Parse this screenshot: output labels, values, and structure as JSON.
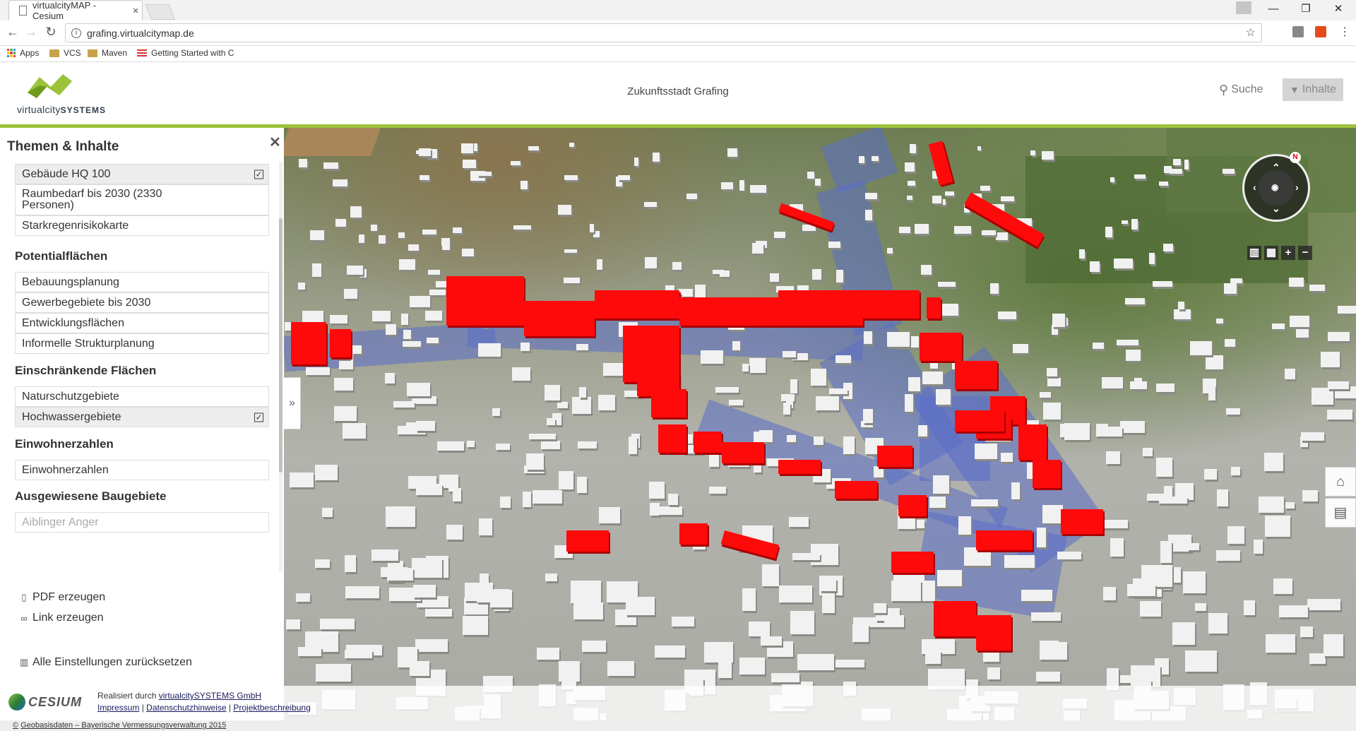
{
  "browser": {
    "tab_title": "virtualcityMAP - Cesium",
    "tab_close": "×",
    "url": "grafing.virtualcitymap.de",
    "bookmarks": [
      {
        "label": "Apps"
      },
      {
        "label": "VCS"
      },
      {
        "label": "Maven"
      },
      {
        "label": "Getting Started with C"
      }
    ],
    "window_controls": {
      "minimize": "—",
      "maximize": "❐",
      "close": "✕"
    }
  },
  "app": {
    "logo_text_a": "virtualcity",
    "logo_text_b": "SYSTEMS",
    "title": "Zukunftsstadt Grafing",
    "search_label": "Suche",
    "contents_label": "Inhalte",
    "brand_color": "#9cc23a"
  },
  "sidebar": {
    "title": "Themen & Inhalte",
    "close": "✕",
    "group0_items": [
      {
        "label": "Gebäude HQ 100",
        "checked": true
      },
      {
        "label": "Raumbedarf bis 2030 (2330 Personen)",
        "checked": false
      },
      {
        "label": "Starkregenrisikokarte",
        "checked": false
      }
    ],
    "sections": [
      {
        "title": "Potentialflächen",
        "items": [
          "Bebauungsplanung",
          "Gewerbegebiete bis 2030",
          "Entwicklungsflächen",
          "Informelle Strukturplanung"
        ]
      },
      {
        "title": "Einschränkende Flächen",
        "items": [
          "Naturschutzgebiete",
          "Hochwassergebiete"
        ]
      },
      {
        "title": "Einwohnerzahlen",
        "items": [
          "Einwohnerzahlen"
        ]
      },
      {
        "title": "Ausgewiesene Baugebiete",
        "items": [
          "Aiblinger Anger"
        ]
      }
    ],
    "checked_flood": true,
    "actions": {
      "pdf": "PDF erzeugen",
      "link": "Link erzeugen",
      "reset": "Alle Einstellungen zurücksetzen"
    }
  },
  "map": {
    "compass_north": "N",
    "flood_color": "#5a6ec8",
    "risk_building_color": "#ff0a0a"
  },
  "footer": {
    "cesium": "CESIUM",
    "realized_by": "Realisiert durch",
    "company_link": "virtualcitySYSTEMS GmbH",
    "impressum": "Impressum",
    "privacy": "Datenschutzhinweise",
    "project": "Projektbeschreibung",
    "separator": "|",
    "attribution_prefix": "©",
    "attribution": "Geobasisdaten – Bayerische Vermessungsverwaltung 2015"
  }
}
